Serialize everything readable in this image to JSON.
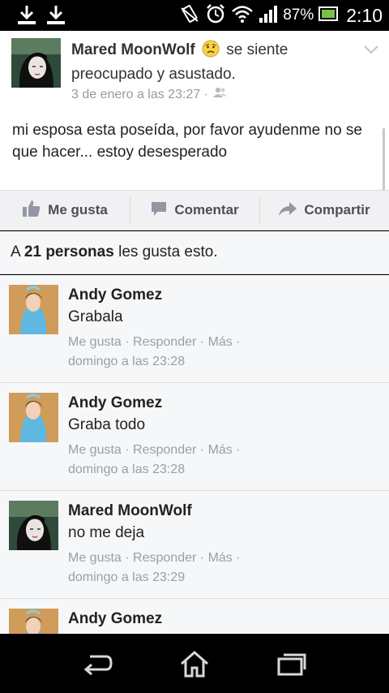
{
  "status_bar": {
    "icons": [
      "download-icon",
      "download-icon",
      "vibrate-icon",
      "alarm-icon",
      "wifi-icon",
      "signal-icon"
    ],
    "battery": "87%",
    "time": "2:10"
  },
  "post": {
    "author": "Mared MoonWolf",
    "feeling": "se siente preocupado y asustado.",
    "timestamp": "3 de enero a las 23:27 ·",
    "text": "mi esposa esta poseída, por favor ayudenme no se que hacer... estoy desesperado"
  },
  "actions": {
    "like": "Me gusta",
    "comment": "Comentar",
    "share": "Compartir"
  },
  "likes": {
    "prefix": "A",
    "count": "21 personas",
    "suffix": "les gusta esto."
  },
  "comment_actions": {
    "like": "Me gusta",
    "reply": "Responder",
    "more": "Más",
    "sep": "·"
  },
  "comments": [
    {
      "author": "Andy Gomez",
      "text": "Grabala",
      "time": "domingo a las 23:28"
    },
    {
      "author": "Andy Gomez",
      "text": "Graba todo",
      "time": "domingo a las 23:28"
    },
    {
      "author": "Mared MoonWolf",
      "text": "no me deja",
      "time": "domingo a las 23:29"
    },
    {
      "author": "Andy Gomez",
      "text": "",
      "time": ""
    }
  ],
  "colors": {
    "background": "#f6f7f9",
    "meta_gray": "#9a9ea6",
    "battery_green": "#7ac142"
  }
}
